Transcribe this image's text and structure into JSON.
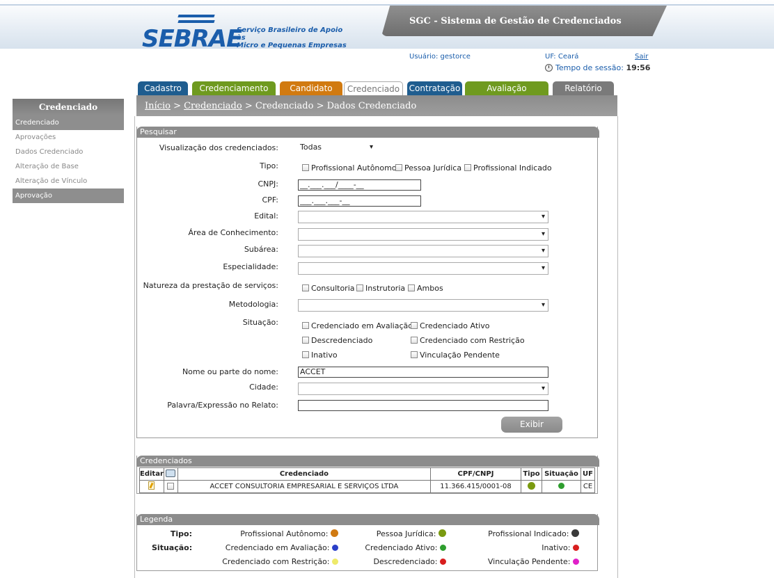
{
  "header": {
    "logo_word": "SEBRAE",
    "logo_tag_line1": "Serviço Brasileiro de Apoio às",
    "logo_tag_line2": "Micro e Pequenas Empresas",
    "system_title": "SGC - Sistema de Gestão de Credenciados",
    "user": "Usuário: gestorce",
    "uf": "UF: Ceará",
    "logout": "Sair",
    "session_label": "Tempo de sessão:",
    "session_time": "19:56"
  },
  "tabs": [
    {
      "label": "Cadastro",
      "color": "#1f5d8f"
    },
    {
      "label": "Credenciamento",
      "color": "#6f9a1f"
    },
    {
      "label": "Candidato",
      "color": "#d17a10"
    },
    {
      "label": "Credenciado",
      "color": "#ffffff"
    },
    {
      "label": "Contratação",
      "color": "#1f5d8f"
    },
    {
      "label": "Avaliação",
      "color": "#6f9a1f"
    },
    {
      "label": "Relatório",
      "color": "#7a7a7a"
    }
  ],
  "breadcrumb": {
    "home": "Início",
    "sep": " > ",
    "section": "Credenciado",
    "rest": " > Credenciado > Dados Credenciado"
  },
  "sidebar": {
    "title": "Credenciado",
    "items": [
      "Credenciado",
      "Aprovações",
      "Dados Credenciado",
      "Alteração de Base",
      "Alteração de Vínculo",
      "Aprovação"
    ]
  },
  "search": {
    "title": "Pesquisar",
    "view_label": "Visualização dos credenciados:",
    "view_value": "Todas",
    "tipo_label": "Tipo:",
    "tipo_options": [
      "Profissional Autônomo",
      "Pessoa Jurídica",
      "Profissional Indicado"
    ],
    "cnpj_label": "CNPJ:",
    "cnpj_mask": "__.___.___/____-__",
    "cpf_label": "CPF:",
    "cpf_mask": "___.___.___-__",
    "edital_label": "Edital:",
    "area_label": "Área de Conhecimento:",
    "subarea_label": "Subárea:",
    "especialidade_label": "Especialidade:",
    "natureza_label": "Natureza da prestação de serviços:",
    "natureza_options": [
      "Consultoria",
      "Instrutoria",
      "Ambos"
    ],
    "metodologia_label": "Metodologia:",
    "situacao_label": "Situação:",
    "situacao_options": [
      "Credenciado em Avaliação",
      "Credenciado Ativo",
      "Descredenciado",
      "Credenciado com Restrição",
      "Inativo",
      "Vinculação Pendente"
    ],
    "nome_label": "Nome ou parte do nome:",
    "nome_value": "ACCET",
    "cidade_label": "Cidade:",
    "palavra_label": "Palavra/Expressão no Relato:",
    "palavra_value": "",
    "submit": "Exibir"
  },
  "results": {
    "title": "Credenciados",
    "columns": {
      "editar": "Editar",
      "credenciado": "Credenciado",
      "cpf": "CPF/CNPJ",
      "tipo": "Tipo",
      "situacao": "Situação",
      "uf": "UF"
    },
    "rows": [
      {
        "nome": "ACCET CONSULTORIA EMPRESARIAL E SERVIÇOS LTDA",
        "cpf_cnpj": "11.366.415/0001-08",
        "tipo_color": "#7a9a10",
        "situacao_color": "#2e9e2e",
        "uf": "CE"
      }
    ]
  },
  "legend": {
    "title": "Legenda",
    "tipo_label": "Tipo:",
    "situacao_label": "Situação:",
    "tipo": [
      {
        "label": "Profissional Autônomo:",
        "color": "#d07a12"
      },
      {
        "label": "Pessoa Jurídica:",
        "color": "#7a9a10"
      },
      {
        "label": "Profissional Indicado:",
        "color": "#3a3a3a"
      }
    ],
    "situacao": [
      {
        "label": "Credenciado em Avaliação:",
        "color": "#2a3fc8"
      },
      {
        "label": "Credenciado Ativo:",
        "color": "#2e9e2e"
      },
      {
        "label": "Inativo:",
        "color": "#d81e1e"
      },
      {
        "label": "Credenciado com Restrição:",
        "color": "#eeea6a"
      },
      {
        "label": "Descredenciado:",
        "color": "#d81e1e"
      },
      {
        "label": "Vinculação Pendente:",
        "color": "#e020c8"
      }
    ]
  }
}
